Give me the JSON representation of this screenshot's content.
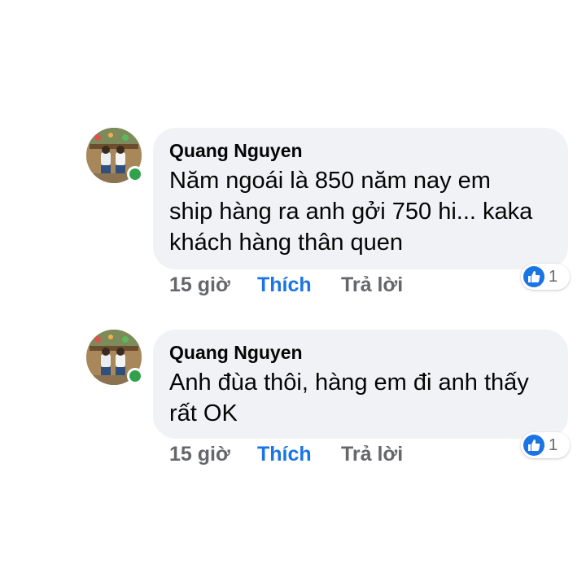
{
  "comments": [
    {
      "author": "Quang Nguyen",
      "lines": [
        "Năm ngoái là 850 năm nay em",
        "ship hàng ra anh gởi 750 hi... kaka",
        "khách hàng thân quen"
      ],
      "time": "15 giờ",
      "like_label": "Thích",
      "reply_label": "Trả lời",
      "reaction_count": "1",
      "reaction_icon": "like-icon",
      "online": true
    },
    {
      "author": "Quang Nguyen",
      "lines": [
        "Anh đùa thôi, hàng em đi anh thấy",
        "rất OK"
      ],
      "time": "15 giờ",
      "like_label": "Thích",
      "reply_label": "Trả lời",
      "reaction_count": "1",
      "reaction_icon": "like-icon",
      "online": true
    }
  ],
  "colors": {
    "bubble": "#f0f2f5",
    "like_blue": "#1b74e4",
    "secondary_text": "#65676b",
    "online_green": "#31a24c"
  }
}
